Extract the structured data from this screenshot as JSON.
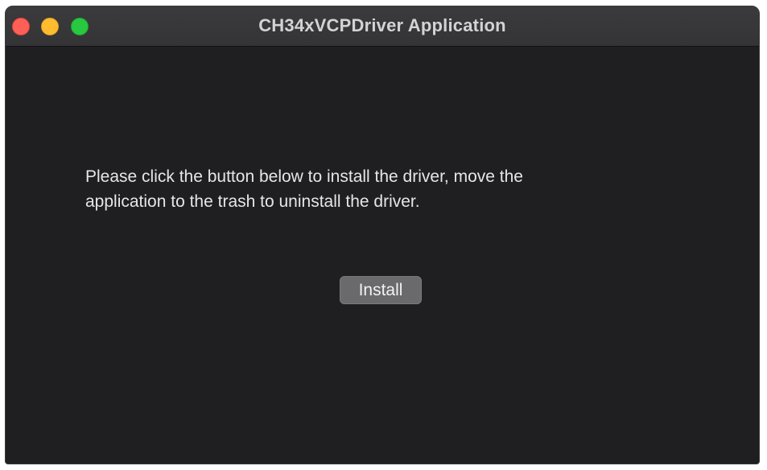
{
  "window": {
    "title": "CH34xVCPDriver Application",
    "traffic_lights": {
      "close": {
        "icon": "close-circle-icon",
        "color": "#fe5f57"
      },
      "minimize": {
        "icon": "minimize-circle-icon",
        "color": "#febc2e"
      },
      "zoom": {
        "icon": "zoom-circle-icon",
        "color": "#28c840"
      }
    }
  },
  "content": {
    "message_line1": "Please click the button below to install the driver, move the",
    "message_line2": "application to the trash to uninstall the driver.",
    "install_label": "Install"
  },
  "colors": {
    "background": "#1f1f21",
    "titlebar": "#363638",
    "text": "#e6e6e8",
    "button": "#6a6a6c"
  }
}
